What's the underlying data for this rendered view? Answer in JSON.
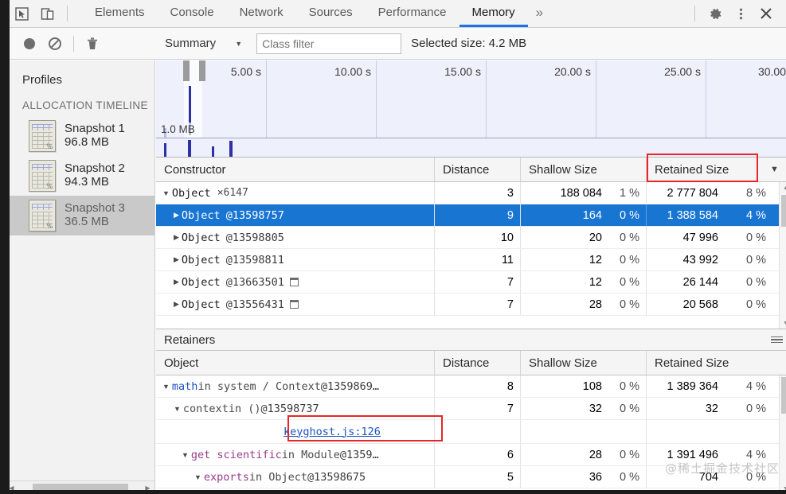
{
  "tabbar": {
    "inspect_icon": "inspect-cursor-icon",
    "device_icon": "device-toolbar-icon",
    "tabs": [
      {
        "label": "Elements",
        "active": false
      },
      {
        "label": "Console",
        "active": false
      },
      {
        "label": "Network",
        "active": false
      },
      {
        "label": "Sources",
        "active": false
      },
      {
        "label": "Performance",
        "active": false
      },
      {
        "label": "Memory",
        "active": true
      }
    ],
    "more_label": "»",
    "settings_icon": "gear-icon",
    "menu_icon": "kebab-menu-icon",
    "close_icon": "close-icon"
  },
  "toolbar": {
    "record_icon": "record-circle-icon",
    "clear_icon": "no-entry-icon",
    "trash_icon": "trash-icon",
    "view_selected": "Summary",
    "view_caret": "▼",
    "class_filter_placeholder": "Class filter",
    "class_filter_value": "",
    "selected_size": "Selected size: 4.2 MB"
  },
  "sidebar": {
    "title": "Profiles",
    "group_label": "ALLOCATION TIMELINE",
    "snapshots": [
      {
        "name": "Snapshot 1",
        "size": "96.8 MB",
        "selected": false
      },
      {
        "name": "Snapshot 2",
        "size": "94.3 MB",
        "selected": false
      },
      {
        "name": "Snapshot 3",
        "size": "36.5 MB",
        "selected": true
      }
    ],
    "snapshot_icon_pct": "%"
  },
  "overview": {
    "mb_label": "1.0 MB",
    "ticks": [
      "5.00 s",
      "10.00 s",
      "15.00 s",
      "20.00 s",
      "25.00 s",
      "30.00"
    ]
  },
  "grid": {
    "columns": [
      "Constructor",
      "Distance",
      "Shallow Size",
      "Retained Size"
    ],
    "sort_caret": "▼",
    "rows": [
      {
        "twisty": "▼",
        "ctor": "Object",
        "id": "",
        "count": "×6147",
        "win": false,
        "distance": "3",
        "shallow": "188 084",
        "shallow_pct": "1 %",
        "retained": "2 777 804",
        "retained_pct": "8 %",
        "selected": false
      },
      {
        "twisty": "▶",
        "ctor": "Object",
        "id": "@13598757",
        "count": "",
        "win": false,
        "distance": "9",
        "shallow": "164",
        "shallow_pct": "0 %",
        "retained": "1 388 584",
        "retained_pct": "4 %",
        "selected": true
      },
      {
        "twisty": "▶",
        "ctor": "Object",
        "id": "@13598805",
        "count": "",
        "win": false,
        "distance": "10",
        "shallow": "20",
        "shallow_pct": "0 %",
        "retained": "47 996",
        "retained_pct": "0 %",
        "selected": false
      },
      {
        "twisty": "▶",
        "ctor": "Object",
        "id": "@13598811",
        "count": "",
        "win": false,
        "distance": "11",
        "shallow": "12",
        "shallow_pct": "0 %",
        "retained": "43 992",
        "retained_pct": "0 %",
        "selected": false
      },
      {
        "twisty": "▶",
        "ctor": "Object",
        "id": "@13663501",
        "count": "",
        "win": true,
        "distance": "7",
        "shallow": "12",
        "shallow_pct": "0 %",
        "retained": "26 144",
        "retained_pct": "0 %",
        "selected": false
      },
      {
        "twisty": "▶",
        "ctor": "Object",
        "id": "@13556431",
        "count": "",
        "win": true,
        "distance": "7",
        "shallow": "28",
        "shallow_pct": "0 %",
        "retained": "20 568",
        "retained_pct": "0 %",
        "selected": false
      }
    ]
  },
  "retainers": {
    "title": "Retainers",
    "columns": [
      "Object",
      "Distance",
      "Shallow Size",
      "Retained Size"
    ],
    "rows": [
      {
        "twisty": "▼",
        "indent": 0,
        "name": "math",
        "name_color": "a",
        "rest": " in system / Context ",
        "id": "@1359869…",
        "distance": "8",
        "shallow": "108",
        "shallow_pct": "0 %",
        "retained": "1 389 364",
        "retained_pct": "4 %"
      },
      {
        "twisty": "▼",
        "indent": 1,
        "name": "context",
        "name_color": "plain",
        "rest": " in () ",
        "id": "@13598737",
        "distance": "7",
        "shallow": "32",
        "shallow_pct": "0 %",
        "retained": "32",
        "retained_pct": "0 %"
      },
      {
        "twisty": "",
        "indent": 3,
        "link": "keyghost.js:126",
        "distance": "",
        "shallow": "",
        "shallow_pct": "",
        "retained": "",
        "retained_pct": ""
      },
      {
        "twisty": "▼",
        "indent": 1,
        "name": "get scientific",
        "name_color": "b",
        "rest": " in Module ",
        "id": "@1359…",
        "distance": "6",
        "shallow": "28",
        "shallow_pct": "0 %",
        "retained": "1 391 496",
        "retained_pct": "4 %"
      },
      {
        "twisty": "▼",
        "indent": 2,
        "name": "exports",
        "name_color": "b",
        "rest": " in Object ",
        "id": "@13598675",
        "distance": "5",
        "shallow": "36",
        "shallow_pct": "0 %",
        "retained": "704",
        "retained_pct": "0 %"
      }
    ]
  },
  "annotations": {
    "retained_size_header_box": "red-highlight",
    "keyghost_link_box": "red-highlight"
  },
  "watermark": "@稀土掘金技术社区",
  "colors": {
    "accent": "#1a73e8",
    "selection": "#1975d2",
    "highlight_red": "#e8262a",
    "timeline_bg": "#eef0fb",
    "timeline_bar": "#2f2fa6"
  }
}
